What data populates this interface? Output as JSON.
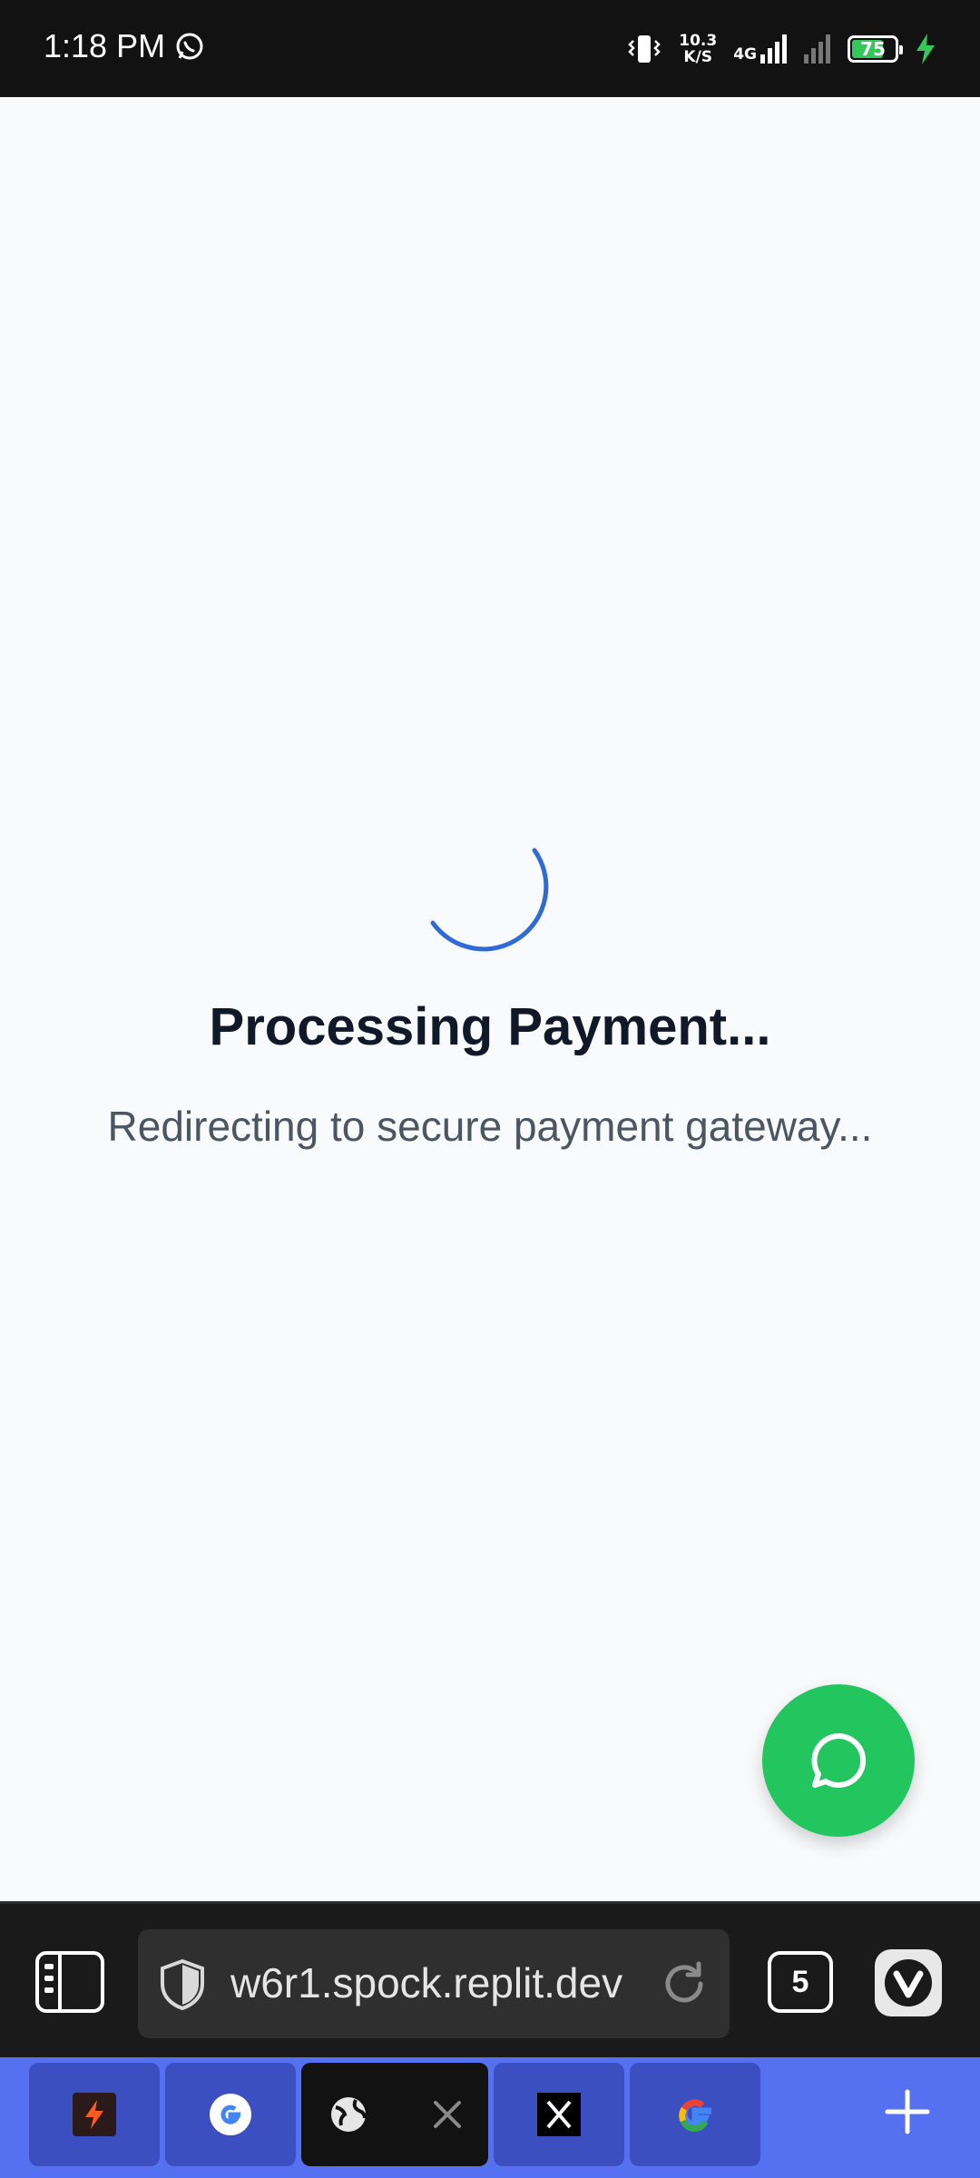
{
  "status_bar": {
    "time": "1:18 PM",
    "net_speed_value": "10.3",
    "net_speed_unit": "K/S",
    "network_type": "4G",
    "battery_level": "75",
    "battery_percent": 75
  },
  "page": {
    "title": "Processing Payment...",
    "subtitle": "Redirecting to secure payment gateway..."
  },
  "browser": {
    "url": "w6r1.spock.replit.dev",
    "tab_count": "5"
  },
  "tabs": [
    {
      "icon": "app-bolt-icon",
      "active": false
    },
    {
      "icon": "google-icon",
      "active": false
    },
    {
      "icon": "globe-icon",
      "active": true
    },
    {
      "icon": "x-logo-icon",
      "active": false
    },
    {
      "icon": "google-icon",
      "active": false
    }
  ],
  "colors": {
    "accent_blue": "#2f6bd8",
    "fab_green": "#22c55e",
    "tabstrip": "#5571f2"
  }
}
